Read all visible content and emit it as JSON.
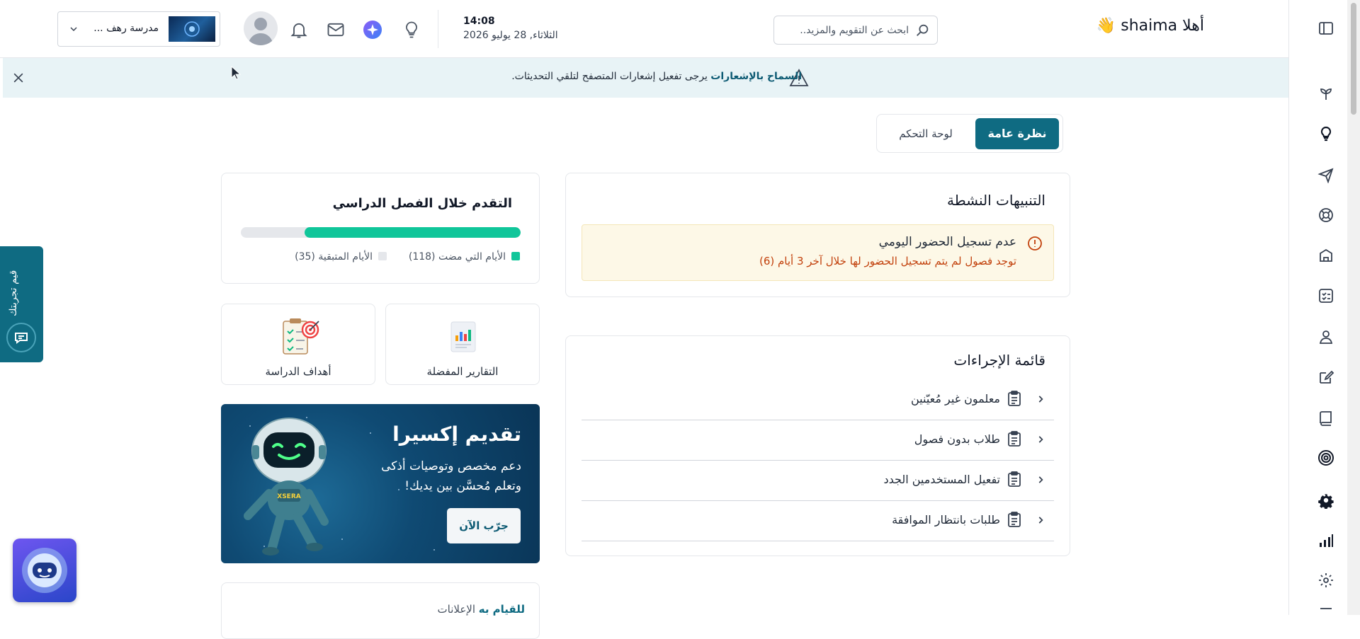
{
  "header": {
    "greeting": "أهلا shaima 👋",
    "search_placeholder": "ابحث عن التقويم والمزيد..",
    "time": "14:08",
    "date": "الثلاثاء, 28 يوليو 2026",
    "school_name": "مدرسة رهف ...",
    "icons": [
      "bulb-icon",
      "ai-assistant-icon",
      "mail-icon",
      "bell-icon",
      "avatar",
      "chevron-down-icon"
    ]
  },
  "banner": {
    "bold": "السماح بالإشعارات",
    "text": "يرجى تفعيل إشعارات المتصفح لتلقي التحديثات."
  },
  "tabs": [
    {
      "label": "نظرة عامة",
      "active": true
    },
    {
      "label": "لوحة التحكم",
      "active": false
    }
  ],
  "alerts_card": {
    "title": "التنبيهات النشطة",
    "alert_title": "عدم تسجيل الحضور اليومي",
    "alert_text": "توجد فصول لم يتم تسجيل الحضور لها خلال آخر 3 أيام (6)"
  },
  "actions_card": {
    "title": "قائمة الإجراءات",
    "items": [
      "معلمون غير مُعيّنين",
      "طلاب بدون فصول",
      "تفعيل المستخدمين الجدد",
      "طلبات بانتظار الموافقة"
    ]
  },
  "progress_card": {
    "title": "التقدم خلال الفصل الدراسي",
    "elapsed_label": "الأيام التي مضت (118)",
    "remaining_label": "الأيام المتبقية (35)",
    "elapsed_days": 118,
    "remaining_days": 35,
    "fill_color": "#10c69a"
  },
  "tiles": {
    "reports": "التقارير المفضلة",
    "goals": "أهداف الدراسة"
  },
  "promo": {
    "title": "تقديم إكسيرا",
    "text": "دعم مخصص وتوصيات أذكى وتعلم مُحسَّن بين يديك!",
    "button": "جرّب الآن",
    "robot_badge": "XSERA"
  },
  "bottom_card": {
    "tab_todo": "للقيام به",
    "tab_announcements": "الإعلانات"
  },
  "feedback_tab": {
    "label": "قيم تجربتك"
  },
  "colors": {
    "primary": "#0f6b82",
    "banner_bg": "#e8f3f6",
    "alert_bg": "#fdf8e7",
    "alert_text": "#c2410c"
  }
}
